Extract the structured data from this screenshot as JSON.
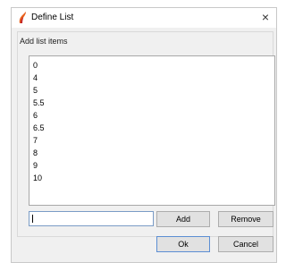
{
  "dialog": {
    "title": "Define List",
    "app_icon": "flame-icon",
    "close_glyph": "×",
    "accent_color": "#e8601c"
  },
  "group": {
    "label": "Add list items"
  },
  "list": {
    "items": [
      "0",
      "4",
      "5",
      "5.5",
      "6",
      "6.5",
      "7",
      "8",
      "9",
      "10"
    ]
  },
  "input": {
    "value": ""
  },
  "buttons": {
    "add": "Add",
    "remove": "Remove",
    "ok": "Ok",
    "cancel": "Cancel"
  }
}
